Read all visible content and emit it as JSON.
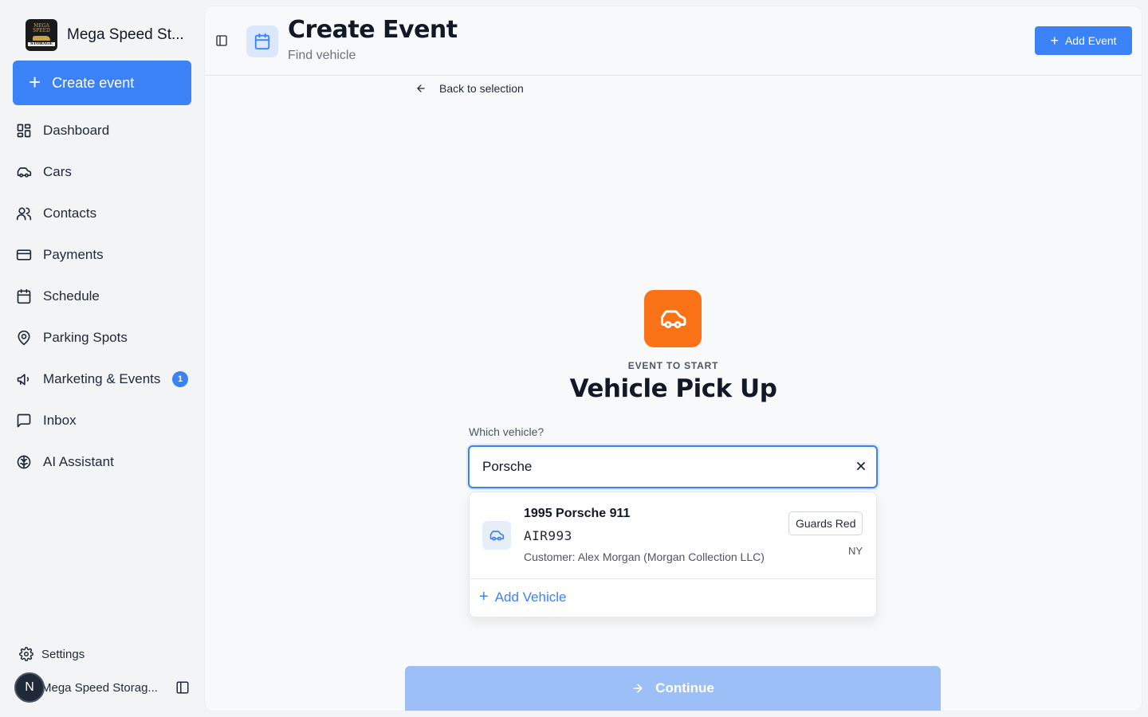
{
  "sidebar": {
    "brand": {
      "name": "Mega Speed St...",
      "logo_top": "MEGA SPEED",
      "logo_bottom": "STORAGE"
    },
    "create_label": "Create event",
    "items": [
      {
        "label": "Dashboard",
        "icon": "dashboard-icon"
      },
      {
        "label": "Cars",
        "icon": "car-icon"
      },
      {
        "label": "Contacts",
        "icon": "users-icon"
      },
      {
        "label": "Payments",
        "icon": "credit-card-icon"
      },
      {
        "label": "Schedule",
        "icon": "calendar-icon"
      },
      {
        "label": "Parking Spots",
        "icon": "map-pin-icon"
      },
      {
        "label": "Marketing & Events",
        "icon": "megaphone-icon",
        "badge": "1"
      },
      {
        "label": "Inbox",
        "icon": "message-icon"
      },
      {
        "label": "AI Assistant",
        "icon": "brain-icon"
      }
    ],
    "settings_label": "Settings",
    "account": {
      "avatar_initial": "N",
      "name": "Mega Speed Storag..."
    }
  },
  "header": {
    "title": "Create Event",
    "subtitle": "Find vehicle",
    "add_event_label": "Add Event"
  },
  "main": {
    "back_label": "Back to selection",
    "event_caption": "EVENT TO START",
    "event_title": "Vehicle Pick Up",
    "field_label": "Which vehicle?",
    "search": {
      "value": "Porsche",
      "placeholder": ""
    },
    "results": [
      {
        "title": "1995 Porsche 911",
        "plate": "AIR993",
        "customer": "Customer: Alex Morgan (Morgan Collection LLC)",
        "color": "Guards Red",
        "state": "NY"
      }
    ],
    "add_vehicle_label": "Add Vehicle",
    "continue_label": "Continue"
  },
  "colors": {
    "accent": "#3b82f6",
    "event_icon": "#f97316",
    "continue_disabled": "#9dbff7"
  }
}
